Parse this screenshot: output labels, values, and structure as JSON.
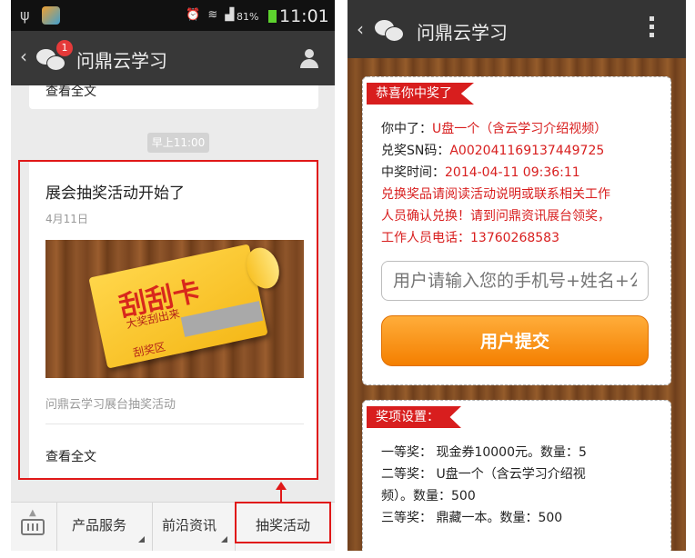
{
  "left": {
    "status_bar": {
      "time": "11:01",
      "battery": "81%"
    },
    "nav": {
      "back": "‹",
      "title": "问鼎云学习",
      "badge": "1"
    },
    "prev_card_read_more": "查看全文",
    "timestamp": "早上11:00",
    "message": {
      "title": "展会抽奖活动开始了",
      "date": "4月11日",
      "cover": {
        "big": "刮刮卡",
        "line1": "大奖刮出来",
        "line2": "刮奖区"
      },
      "description": "问鼎云学习展台抽奖活动",
      "read_more": "查看全文"
    },
    "bottom_menu": [
      "产品服务",
      "前沿资讯",
      "抽奖活动"
    ]
  },
  "right": {
    "nav": {
      "back": "‹",
      "title": "问鼎云学习"
    },
    "prize": {
      "ribbon": "恭喜你中奖了",
      "won_label": "你中了：",
      "won_value": "U盘一个（含云学习介绍视频）",
      "sn_label": "兑奖SN码：",
      "sn_value": "A002041169137449725",
      "time_label": "中奖时间：",
      "time_value": "2014-04-11 09:36:11",
      "notice_lines": [
        "兑换奖品请阅读活动说明或联系相关工作",
        "人员确认兑换！请到问鼎资讯展台领奖，",
        "工作人员电话：13760268583"
      ],
      "input_placeholder": "用户请输入您的手机号+姓名+公司",
      "submit": "用户提交"
    },
    "settings": {
      "ribbon": "奖项设置：",
      "lines": [
        "一等奖：  现金券10000元。数量：5",
        "二等奖：  U盘一个（含云学习介绍视",
        "频）。数量：500",
        "三等奖：  鼎藏一本。数量：500"
      ]
    }
  },
  "colors": {
    "accent_red": "#d81e1e",
    "button_orange": "#f47f00",
    "nav_dark": "#383838"
  }
}
